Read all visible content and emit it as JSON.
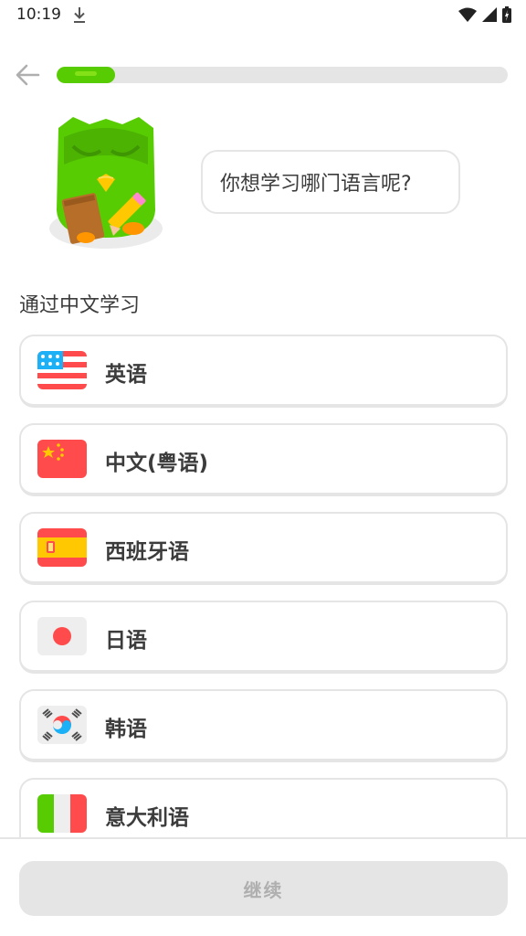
{
  "status_bar": {
    "time": "10:19",
    "icons": [
      "download-icon",
      "wifi-icon",
      "signal-icon",
      "battery-icon"
    ]
  },
  "header": {
    "back_icon": "arrow-left-icon",
    "progress": 0.13,
    "progress_color": "#58cc02"
  },
  "mascot": {
    "speech": "你想学习哪门语言呢?"
  },
  "section": {
    "title": "通过中文学习"
  },
  "languages": [
    {
      "label": "英语",
      "flag": "us-flag-icon"
    },
    {
      "label": "中文(粤语)",
      "flag": "china-flag-icon"
    },
    {
      "label": "西班牙语",
      "flag": "spain-flag-icon"
    },
    {
      "label": "日语",
      "flag": "japan-flag-icon"
    },
    {
      "label": "韩语",
      "flag": "korea-flag-icon"
    },
    {
      "label": "意大利语",
      "flag": "italy-flag-icon"
    }
  ],
  "footer": {
    "continue_label": "继续"
  }
}
